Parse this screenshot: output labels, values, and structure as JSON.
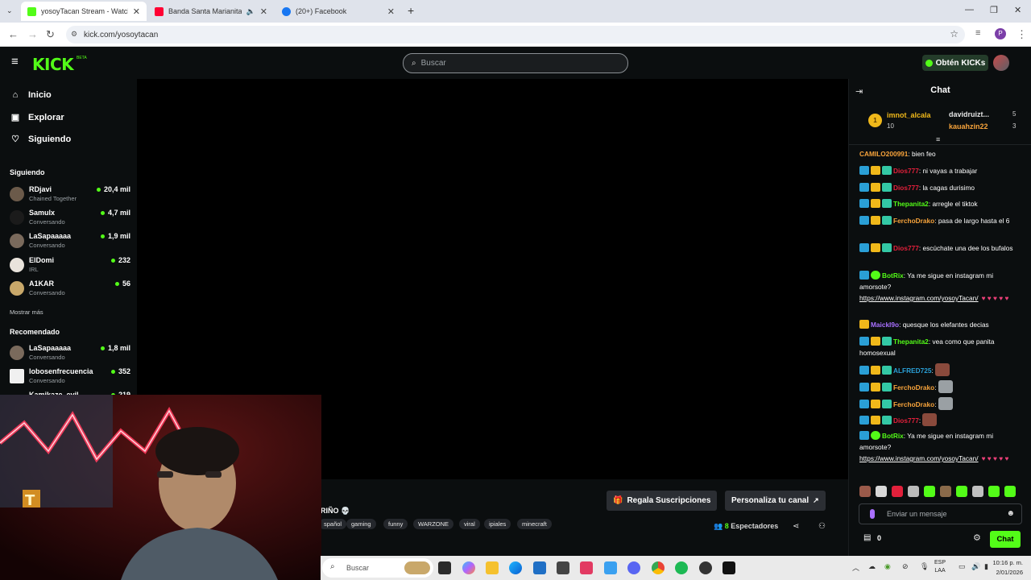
{
  "browser": {
    "tabs": [
      {
        "title": "yosoyTacan Stream - Watch Live",
        "favicon": "kick",
        "active": true
      },
      {
        "title": "Banda Santa Marianita del",
        "favicon": "youtube",
        "active": false
      },
      {
        "title": "(20+) Facebook",
        "favicon": "facebook",
        "active": false
      }
    ],
    "url": "kick.com/yosoytacan",
    "profile_initial": "P"
  },
  "header": {
    "logo": "KICK",
    "logo_badge": "BETA",
    "search_placeholder": "Buscar",
    "get_kicks_label": "Obtén KICKs"
  },
  "sidebar": {
    "nav": [
      {
        "label": "Inicio",
        "icon": "home-icon"
      },
      {
        "label": "Explorar",
        "icon": "compass-icon"
      },
      {
        "label": "Siguiendo",
        "icon": "heart-icon"
      }
    ],
    "following_title": "Siguiendo",
    "following": [
      {
        "name": "RDjavi",
        "category": "Chained Together",
        "viewers": "20,4 mil"
      },
      {
        "name": "Samulx",
        "category": "Conversando",
        "viewers": "4,7 mil"
      },
      {
        "name": "LaSapaaaaa",
        "category": "Conversando",
        "viewers": "1,9 mil"
      },
      {
        "name": "ElDomi",
        "category": "IRL",
        "viewers": "232"
      },
      {
        "name": "A1KAR",
        "category": "Conversando",
        "viewers": "56"
      }
    ],
    "show_more": "Mostrar más",
    "recommended_title": "Recomendado",
    "recommended": [
      {
        "name": "LaSapaaaaa",
        "category": "Conversando",
        "viewers": "1,8 mil"
      },
      {
        "name": "lobosenfrecuencia",
        "category": "Conversando",
        "viewers": "352"
      },
      {
        "name": "Kamikaze_evil",
        "category": "",
        "viewers": "219"
      }
    ]
  },
  "stream": {
    "title_fragment": "RIÑO 💀",
    "tags": [
      "spañol",
      "gaming",
      "funny",
      "WARZONE",
      "viral",
      "ipiales",
      "minecraft"
    ],
    "gift_subs_label": "Regala Suscripciones",
    "customize_label": "Personaliza tu canal",
    "viewers_count": "8",
    "viewers_label": "Espectadores"
  },
  "chat": {
    "title": "Chat",
    "top_gifters": [
      {
        "rank": "1",
        "name": "imnot_alcala",
        "count": "10"
      },
      {
        "name": "davidruizt...",
        "count": "5"
      },
      {
        "name": "kauahzin22",
        "count": "3"
      }
    ],
    "messages": [
      {
        "user": "CAMILO200991",
        "color": "#f7a33b",
        "text": "bien feo",
        "badges": []
      },
      {
        "user": "Dios777",
        "color": "#e2203b",
        "text": "ni vayas a trabajar",
        "badges": [
          "blue",
          "gold",
          "teal"
        ]
      },
      {
        "user": "Dios777",
        "color": "#e2203b",
        "text": "la cagas durisimo",
        "badges": [
          "blue",
          "gold",
          "teal"
        ]
      },
      {
        "user": "Thepanita2",
        "color": "#53fc18",
        "text": "arregle el tiktok",
        "badges": [
          "blue",
          "gold",
          "teal"
        ]
      },
      {
        "user": "FerchoDrako",
        "color": "#f7a33b",
        "text": "pasa de largo hasta el 6",
        "badges": [
          "blue",
          "gold",
          "teal"
        ]
      },
      {
        "user": "Dios777",
        "color": "#e2203b",
        "text": "escúchate una dee los bufalos",
        "badges": [
          "blue",
          "gold",
          "teal"
        ]
      },
      {
        "user": "BotRix",
        "color": "#53fc18",
        "text": "Ya me sigue en instagram mi amorsote?",
        "link": "https://www.instagram.com/yosoyTacan/",
        "hearts": "♥ ♥ ♥ ♥ ♥",
        "badges": [
          "blue",
          "green"
        ]
      },
      {
        "user": "MaickI9o",
        "color": "#a970ff",
        "text": "quesque los elefantes decias",
        "badges": [
          "gold"
        ]
      },
      {
        "user": "Thepanita2",
        "color": "#53fc18",
        "text": "vea como que panita homosexual",
        "badges": [
          "blue",
          "gold",
          "teal"
        ]
      },
      {
        "user": "ALFRED725",
        "color": "#2a9fd6",
        "text": "",
        "emote": "#8a4a3c",
        "badges": [
          "blue",
          "gold",
          "teal"
        ]
      },
      {
        "user": "FerchoDrako",
        "color": "#f7a33b",
        "text": "",
        "emote": "#9aa0a4",
        "badges": [
          "blue",
          "gold",
          "teal"
        ]
      },
      {
        "user": "FerchoDrako",
        "color": "#f7a33b",
        "text": "",
        "emote": "#9aa0a4",
        "badges": [
          "blue",
          "gold",
          "teal"
        ]
      },
      {
        "user": "Dios777",
        "color": "#e2203b",
        "text": "",
        "emote": "#8a4a3c",
        "badges": [
          "blue",
          "gold",
          "teal"
        ]
      },
      {
        "user": "BotRix",
        "color": "#53fc18",
        "text": "Ya me sigue en instagram mi amorsote?",
        "link": "https://www.instagram.com/yosoyTacan/",
        "hearts": "♥ ♥ ♥ ♥ ♥",
        "badges": [
          "blue",
          "green"
        ]
      }
    ],
    "input_placeholder": "Enviar un mensaje",
    "kicks_count": "0",
    "send_label": "Chat"
  },
  "taskbar": {
    "search_placeholder": "Buscar",
    "lang_top": "ESP",
    "lang_bottom": "LAA",
    "time": "10:16 p. m.",
    "date": "2/01/2026"
  },
  "colors": {
    "kick_green": "#53fc18",
    "background": "#0b0e0f"
  }
}
